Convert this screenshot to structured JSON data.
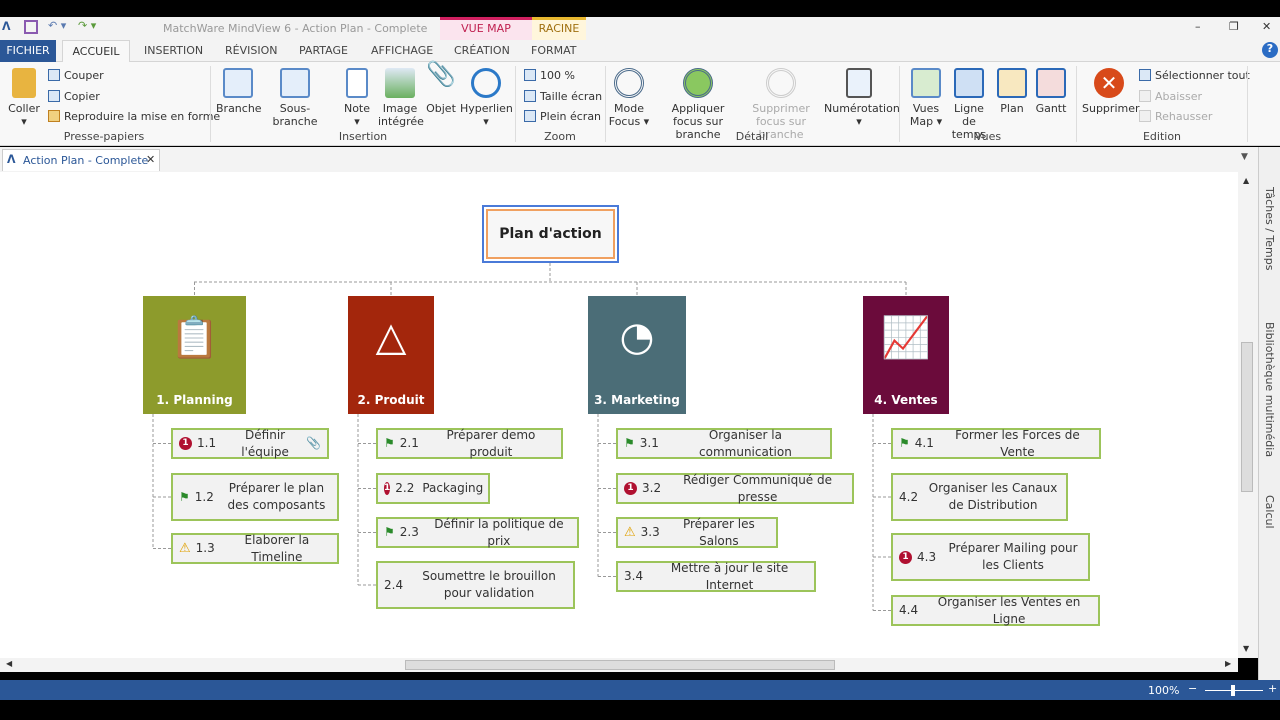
{
  "window": {
    "title": "MatchWare MindView 6 - Action Plan - Complete",
    "context_tabs": [
      "VUE MAP",
      "RACINE"
    ]
  },
  "tabs": [
    "FICHIER",
    "ACCUEIL",
    "INSERTION",
    "RÉVISION",
    "PARTAGE",
    "AFFICHAGE",
    "CRÉATION",
    "FORMAT"
  ],
  "ribbon": {
    "clipboard": {
      "paste": "Coller",
      "cut": "Couper",
      "copy": "Copier",
      "format": "Reproduire la mise en forme",
      "group": "Presse-papiers"
    },
    "insertion": {
      "branch": "Branche",
      "subbranch": "Sous-branche",
      "note": "Note",
      "image": "Image intégrée",
      "object": "Objet",
      "hyperlink": "Hyperlien",
      "group": "Insertion"
    },
    "zoom": {
      "z100": "100 %",
      "fit": "Taille écran",
      "full": "Plein écran",
      "group": "Zoom"
    },
    "detail": {
      "focus": "Mode Focus",
      "apply": "Appliquer focus sur branche",
      "remove": "Supprimer focus sur branche",
      "numbering": "Numérotation",
      "group": "Détail"
    },
    "views": {
      "map": "Vues Map",
      "timeline": "Ligne de temps",
      "plan": "Plan",
      "gantt": "Gantt",
      "group": "Vues"
    },
    "edition": {
      "delete": "Supprimer",
      "select_all": "Sélectionner tout",
      "demote": "Abaisser",
      "promote": "Rehausser",
      "group": "Edition"
    }
  },
  "doc_tab": "Action Plan - Complete",
  "side_panels": [
    "Tâches / Temps",
    "Bibliothèque multimédia",
    "Calcul"
  ],
  "status": {
    "zoom": "100%"
  },
  "map": {
    "root": "Plan d'action",
    "branches": [
      {
        "label": "1.  Planning",
        "color": "#8d9b2c",
        "subs": [
          {
            "num": "1.1",
            "text": "Définir l'équipe",
            "icon": "priority"
          },
          {
            "num": "1.2",
            "text": "Préparer le plan des composants",
            "icon": "flag"
          },
          {
            "num": "1.3",
            "text": "Elaborer la Timeline",
            "icon": "warning"
          }
        ]
      },
      {
        "label": "2.  Produit",
        "color": "#a3260c",
        "subs": [
          {
            "num": "2.1",
            "text": "Préparer demo produit",
            "icon": "flag"
          },
          {
            "num": "2.2",
            "text": "Packaging",
            "icon": "priority"
          },
          {
            "num": "2.3",
            "text": "Définir la politique de prix",
            "icon": "flag"
          },
          {
            "num": "2.4",
            "text": "Soumettre le brouillon pour validation",
            "icon": ""
          }
        ]
      },
      {
        "label": "3.  Marketing",
        "color": "#4b6d77",
        "subs": [
          {
            "num": "3.1",
            "text": "Organiser la communication",
            "icon": "flag"
          },
          {
            "num": "3.2",
            "text": "Rédiger Communiqué de presse",
            "icon": "priority"
          },
          {
            "num": "3.3",
            "text": "Préparer les Salons",
            "icon": "warning"
          },
          {
            "num": "3.4",
            "text": "Mettre à jour le site Internet",
            "icon": ""
          }
        ]
      },
      {
        "label": "4.  Ventes",
        "color": "#6b0b3b",
        "subs": [
          {
            "num": "4.1",
            "text": "Former les Forces de Vente",
            "icon": "flag"
          },
          {
            "num": "4.2",
            "text": "Organiser les Canaux de Distribution",
            "icon": ""
          },
          {
            "num": "4.3",
            "text": "Préparer Mailing pour les Clients",
            "icon": "priority"
          },
          {
            "num": "4.4",
            "text": "Organiser les Ventes en Ligne",
            "icon": ""
          }
        ]
      }
    ]
  }
}
